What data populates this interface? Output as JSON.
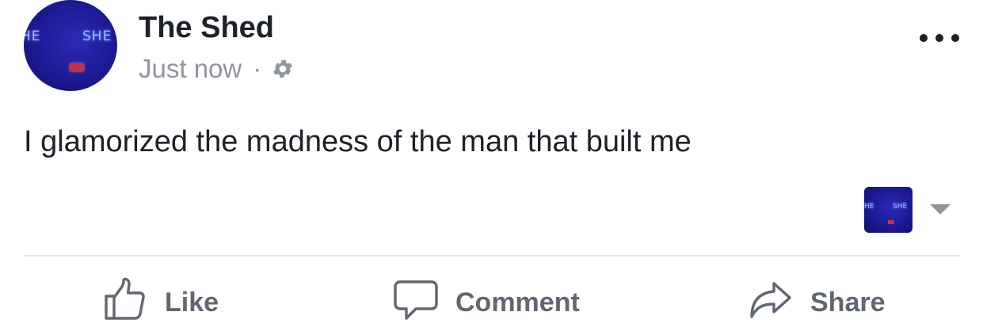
{
  "post": {
    "author": "The Shed",
    "timestamp": "Just now",
    "separator": "·",
    "privacy_icon": "gear-icon",
    "message": "I glamorized the madness of the man that built me",
    "avatar_neon_left": "HE",
    "avatar_neon_right": "SHE",
    "more_icon": "ellipsis-icon"
  },
  "audience": {
    "neon_left": "HE",
    "neon_right": "SHE",
    "dropdown_icon": "caret-down-icon"
  },
  "actions": {
    "like_label": "Like",
    "comment_label": "Comment",
    "share_label": "Share"
  },
  "colors": {
    "text_primary": "#1d2129",
    "text_secondary": "#90949c",
    "action_text": "#606770",
    "divider": "#e5e5e5",
    "avatar_blue": "#1c1a92"
  }
}
